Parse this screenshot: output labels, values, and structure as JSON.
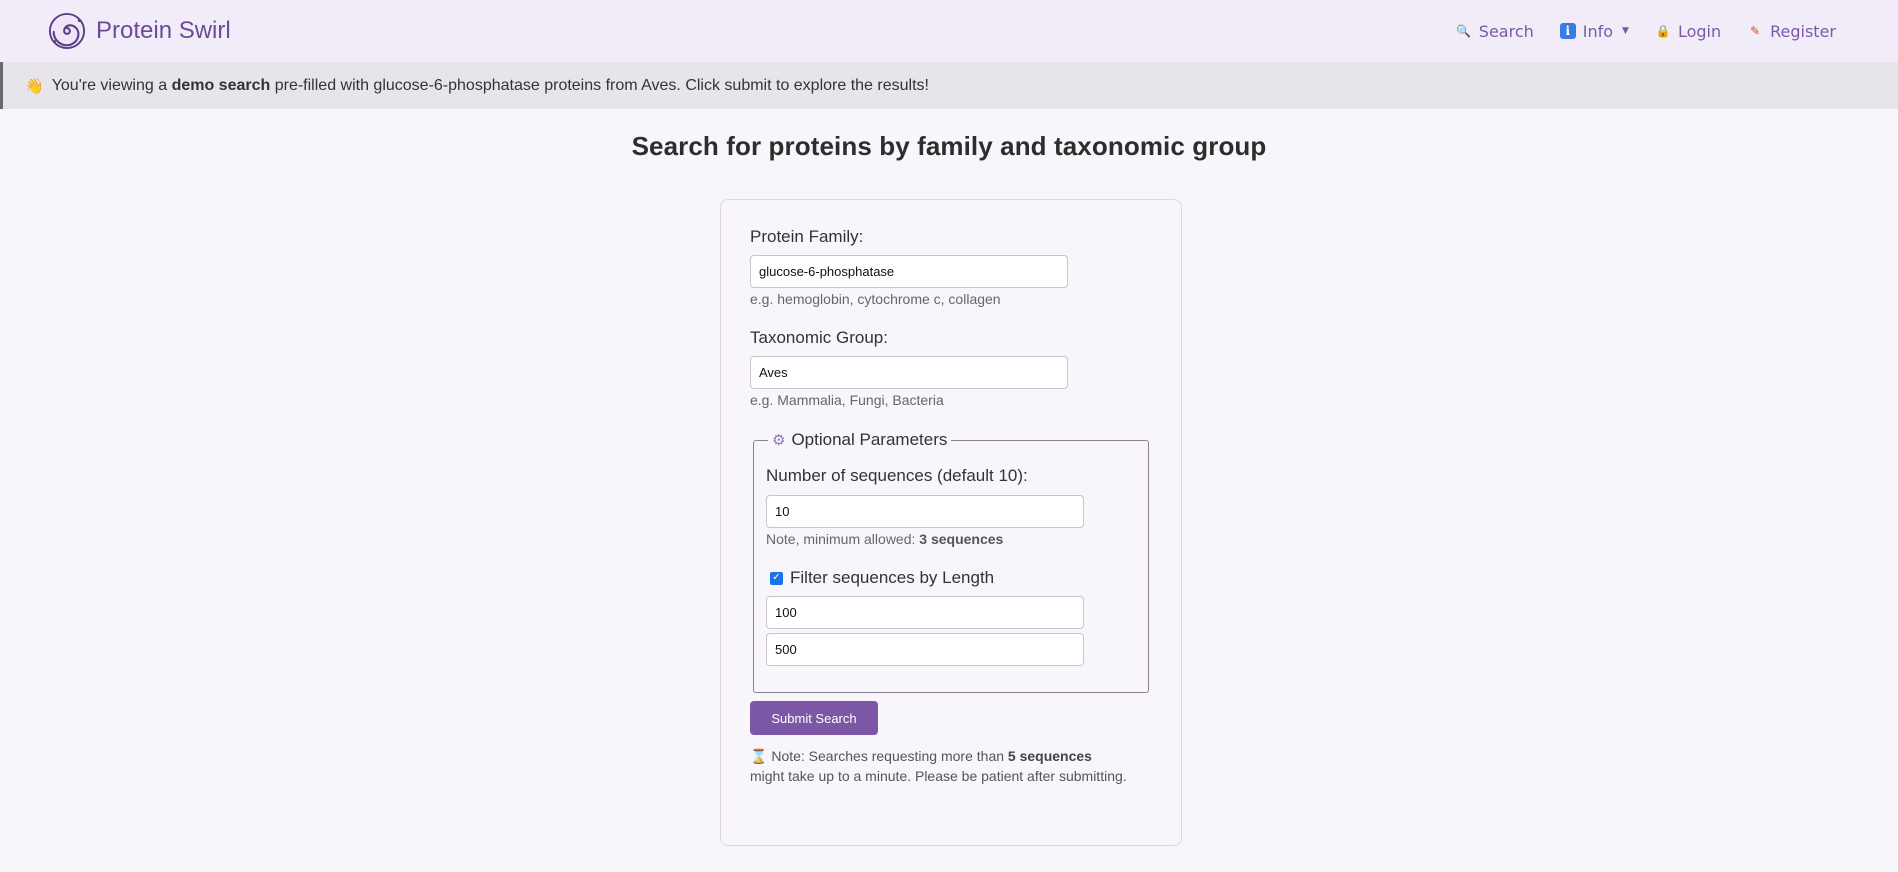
{
  "nav": {
    "brand": "Protein Swirl",
    "links": [
      {
        "label": "Search",
        "icon": "search-icon"
      },
      {
        "label": "Info",
        "icon": "info-icon"
      },
      {
        "label": "Login",
        "icon": "lock-icon"
      },
      {
        "label": "Register",
        "icon": "register-icon"
      }
    ]
  },
  "banner": {
    "icon": "wave-icon",
    "prefix": "You're viewing a ",
    "bold": "demo search",
    "suffix": " pre-filled with glucose-6-phosphatase proteins from Aves. Click submit to explore the results!"
  },
  "page": {
    "title": "Search for proteins by family and taxonomic group"
  },
  "form": {
    "family_label": "Protein Family:",
    "family_value": "glucose-6-phosphatase",
    "family_hint": "e.g. hemoglobin, cytochrome c, collagen",
    "taxon_label": "Taxonomic Group:",
    "taxon_value": "Aves",
    "taxon_hint": "e.g. Mammalia, Fungi, Bacteria",
    "optional_legend": "Optional Parameters",
    "num_seq_label": "Number of sequences (default 10):",
    "num_seq_value": "10",
    "num_seq_note_prefix": "Note, minimum allowed: ",
    "num_seq_note_bold": "3 sequences",
    "filter_label": "Filter sequences by Length",
    "filter_checked": true,
    "min_length": "100",
    "max_length": "500",
    "submit_label": "Submit Search",
    "note_prefix": "Note: Searches requesting more than ",
    "note_bold": "5 sequences",
    "note_suffix": " might take up to a minute. Please be patient after submitting."
  },
  "colors": {
    "accent": "#7b57a6",
    "nav_bg": "#f1ecf7",
    "banner_bg": "#e8e5ea"
  }
}
